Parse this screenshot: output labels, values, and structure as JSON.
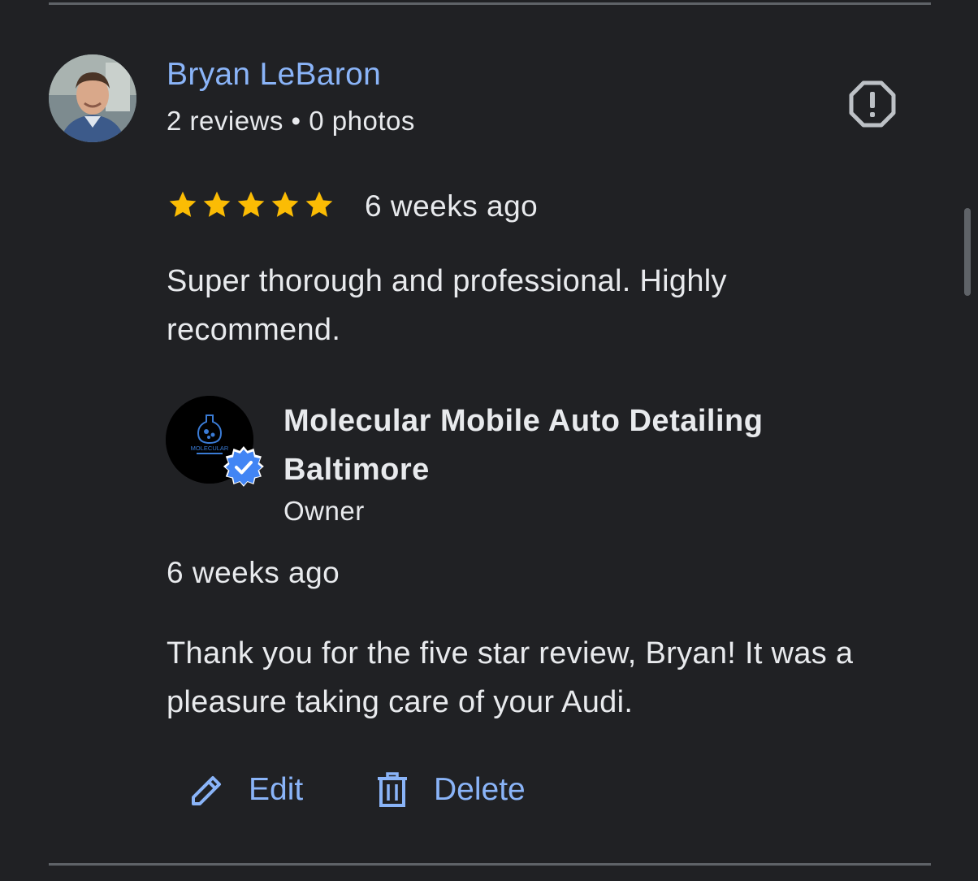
{
  "review": {
    "reviewer": {
      "name": "Bryan LeBaron",
      "meta": "2 reviews • 0 photos"
    },
    "rating": 5,
    "rating_max": 5,
    "time": "6 weeks ago",
    "text": "Super thorough and professional. Highly recommend."
  },
  "owner_reply": {
    "business_name": "Molecular Mobile Auto Detailing Baltimore",
    "role": "Owner",
    "logo_text": "MOLECULAR",
    "time": "6 weeks ago",
    "text": "Thank you for the five star review, Bryan! It was a pleasure taking care of your Audi."
  },
  "actions": {
    "edit_label": "Edit",
    "delete_label": "Delete"
  },
  "icons": {
    "report": "report-octagon-icon",
    "star": "star-icon",
    "verified": "verified-badge-icon",
    "edit": "pencil-icon",
    "delete": "trash-icon"
  },
  "colors": {
    "background": "#202124",
    "link": "#8ab4f8",
    "star": "#fbbc04",
    "verified": "#4285f4",
    "divider": "#5f6368"
  }
}
